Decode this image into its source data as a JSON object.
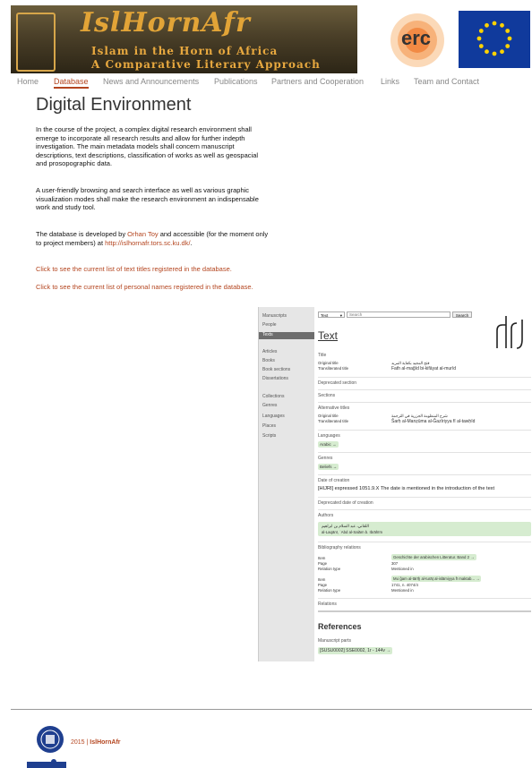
{
  "header": {
    "logo_title": "IslHornAfr",
    "logo_sub1": "Islam in the Horn of Africa",
    "logo_sub2": "A Comparative Literary Approach",
    "erc": "erc"
  },
  "nav": [
    "Home",
    "Database",
    "News and Announcements",
    "Publications",
    "Partners and Cooperation",
    "Links",
    "Team and Contact"
  ],
  "page": {
    "title": "Digital Environment",
    "p1": "In the course of the project, a complex digital research environment shall emerge to incorporate all research results and allow for further indepth investigation. The main metadata models shall concern manuscript descriptions, text descriptions, classification of works as well as geospacial and prosopographic data.",
    "p2": "A user-friendly browsing and search interface as well as various graphic visualization modes shall make the research environment an indispensable work and study tool.",
    "p3_a": "The database is developed by ",
    "p3_link1": "Orhan Toy",
    "p3_b": " and accessible (for the moment only to project members) at ",
    "p3_link2": "http://islhornafr.tors.sc.ku.dk/",
    "p3_c": ".",
    "link_titles": "Click to see the current list of text titles registered in the database.",
    "link_names": "Click to see the current list of personal names registered in the database."
  },
  "db": {
    "side": [
      "Manuscripts",
      "People",
      "Texts",
      "Articles",
      "Books",
      "Book sections",
      "Dissertations",
      "Collections",
      "Genres",
      "Languages",
      "Places",
      "Scripts"
    ],
    "search_select": "Text",
    "search_placeholder": "Search",
    "search_button": "Search",
    "heading": "Text",
    "title_label": "Title",
    "orig_title_label": "Original title",
    "orig_title": "فتح المجيد بكفاية المريد",
    "translit_label": "Transliterated title",
    "translit": "Fath al-maǧīd bi-kifāyat al-murīd",
    "deprecated_section": "Deprecated section",
    "sections": "Sections",
    "alt_titles": "Alternative titles",
    "alt_orig": "شرح المنظومة الجزرية في الترجمة",
    "alt_translit": "Šarḥ al-Manẓūma al-Ǧazīriyya fī al-tawḥīd",
    "languages": "Languages",
    "lang_val": "Arabic →",
    "genres": "Genres",
    "genre_val": "Beliefs →",
    "date_label": "Date of creation",
    "date_val": "[HIJRI] expressed 1051.9.X The date is mentioned in the introduction of the text",
    "dep_date": "Deprecated date of creation",
    "authors": "Authors",
    "author_ar": "اللقاني، عبد السلام بن ابراهيم",
    "author_lat": "al-Laqānī, ʿAbd al-Salām b. Ibrāhīm",
    "biblio": "Bibliography relations",
    "item_label": "Item",
    "page_label": "Page",
    "rel_label": "Relation type",
    "b1_item": "Geschichte der arabischen Litteratur. Band 2 →",
    "b1_page": "307",
    "b1_rel": "Mentioned in",
    "b2_item": "Muʿǧam al-tārīḫ al-turāṯ al-islāmiyya fī maktab... →",
    "b2_page": "1741, n. 4074/4",
    "b2_rel": "Mentioned in",
    "relations": "Relations",
    "references": "References",
    "ms_parts": "Manuscript parts",
    "ms_val": "[SUSU0002] SSE0002, 1r - 144v →"
  },
  "footer": {
    "copyright_year": "2015 | ",
    "copyright_name": "IslHornAfr"
  },
  "colors": {
    "accent": "#b4451f",
    "banner_text": "#e2a437",
    "eu_blue": "#103a9c"
  }
}
